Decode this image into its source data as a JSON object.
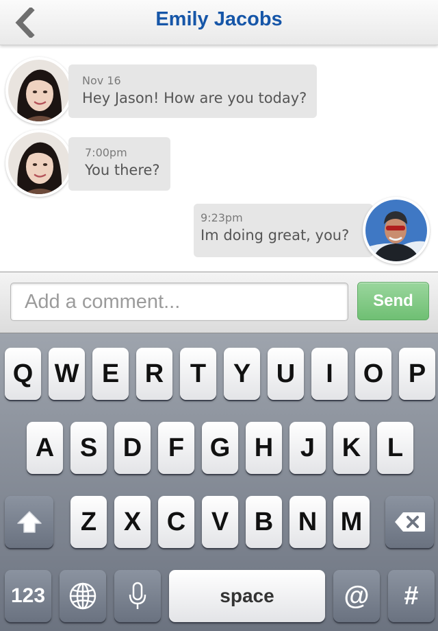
{
  "header": {
    "title": "Emily Jacobs",
    "back_icon": "chevron-left-icon"
  },
  "messages": [
    {
      "from": "contact",
      "time": "Nov 16",
      "text": "Hey Jason! How are you today?"
    },
    {
      "from": "contact",
      "time": "7:00pm",
      "text": "You there?"
    },
    {
      "from": "me",
      "time": "9:23pm",
      "text": "Im doing great, you?"
    }
  ],
  "composer": {
    "placeholder": "Add a comment...",
    "value": "",
    "send_label": "Send"
  },
  "keyboard": {
    "row1": [
      "Q",
      "W",
      "E",
      "R",
      "T",
      "Y",
      "U",
      "I",
      "O",
      "P"
    ],
    "row2": [
      "A",
      "S",
      "D",
      "F",
      "G",
      "H",
      "J",
      "K",
      "L"
    ],
    "row3": [
      "Z",
      "X",
      "C",
      "V",
      "B",
      "N",
      "M"
    ],
    "numbers_label": "123",
    "space_label": "space",
    "at_label": "@",
    "hash_label": "#",
    "icons": [
      "shift-icon",
      "backspace-icon",
      "globe-icon",
      "microphone-icon"
    ]
  },
  "colors": {
    "title": "#1656a8",
    "bubble": "#e6e6e6",
    "send_button": "#7cc47f"
  }
}
